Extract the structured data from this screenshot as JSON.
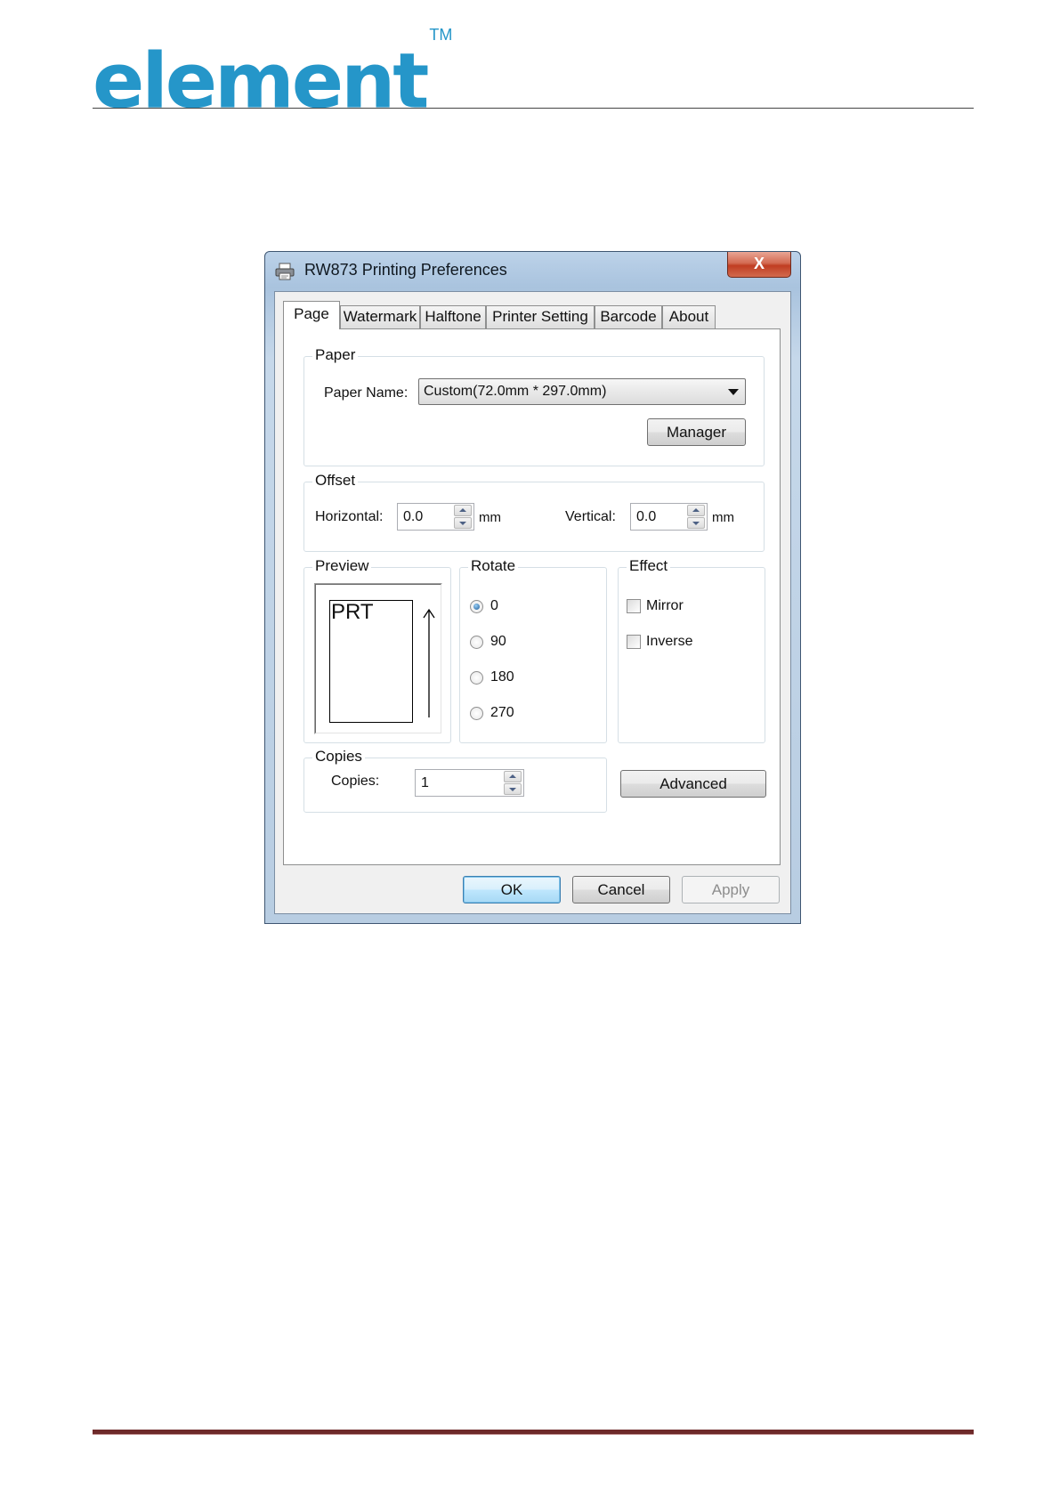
{
  "doc": {
    "logo_text": "element",
    "logo_tm": "TM"
  },
  "dialog": {
    "title": "RW873 Printing Preferences",
    "close_glyph": "X",
    "tabs": [
      "Page",
      "Watermark",
      "Halftone",
      "Printer Setting",
      "Barcode",
      "About"
    ],
    "active_tab": "Page",
    "paper": {
      "group_label": "Paper",
      "name_label": "Paper Name:",
      "name_value": "Custom(72.0mm * 297.0mm)",
      "manager_button": "Manager"
    },
    "offset": {
      "group_label": "Offset",
      "horizontal_label": "Horizontal:",
      "horizontal_value": "0.0",
      "horizontal_unit": "mm",
      "vertical_label": "Vertical:",
      "vertical_value": "0.0",
      "vertical_unit": "mm"
    },
    "preview": {
      "group_label": "Preview",
      "paper_text": "PRT",
      "arrow_glyph": "↑"
    },
    "rotate": {
      "group_label": "Rotate",
      "options": [
        "0",
        "90",
        "180",
        "270"
      ],
      "selected": "0"
    },
    "effect": {
      "group_label": "Effect",
      "mirror_label": "Mirror",
      "mirror_checked": false,
      "inverse_label": "Inverse",
      "inverse_checked": false
    },
    "copies": {
      "group_label": "Copies",
      "label": "Copies:",
      "value": "1"
    },
    "advanced_button": "Advanced",
    "footer": {
      "ok": "OK",
      "cancel": "Cancel",
      "apply": "Apply"
    }
  }
}
